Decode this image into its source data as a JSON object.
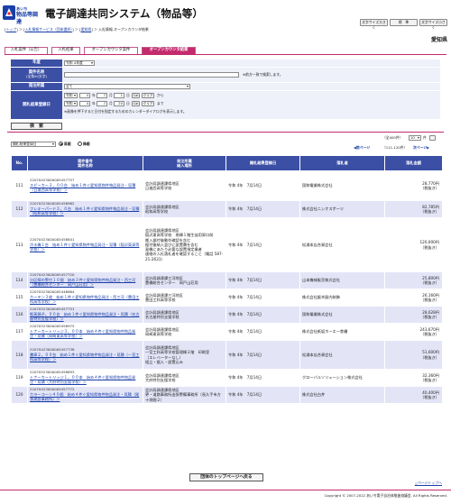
{
  "header": {
    "logo_small": "あいち",
    "logo_main": "物品等調達",
    "system_name": "電子調達共同システム（物品等）",
    "buttons": [
      "文字サイズ大きく",
      "標　準",
      "文字サイズ小さく"
    ]
  },
  "breadcrumb": {
    "items": [
      "トップ",
      "入札情報サービス（団体選択）",
      "愛知県"
    ],
    "current": "入札情報-オープンカウンタ結果",
    "sep": "＞"
  },
  "org_name": "愛知県",
  "tabs": [
    "入札案件（公告）",
    "入札結果",
    "オープンカウンタ案件",
    "オープンカウンタ結果"
  ],
  "search": {
    "fiscal_year_label": "年度",
    "fiscal_year_value": "令和 4年度",
    "case_name_label": "案件名称",
    "case_name_sub": "(全角50文字)",
    "case_name_note": "※前方一致で検索します。",
    "issuer_label": "発注所属",
    "issuer_value": "全て",
    "date_label": "開札結果登録日",
    "date_from": {
      "era": "令和",
      "y": "4",
      "m": "7",
      "d": "1",
      "from_word": "から"
    },
    "date_to": {
      "era": "令和",
      "y": "4",
      "m": "7",
      "d": "20",
      "to_word": "まで"
    },
    "unit_y": "年",
    "unit_m": "月",
    "unit_d": "日",
    "cal_btn": "Cal",
    "clear_btn": "クリア",
    "date_note": "※画像を押下すると日付を指定するためのカレンダーダイアログを表示します。",
    "search_btn": "検　索"
  },
  "list_controls": {
    "sort_value": "開札結果登録日",
    "asc": "昇順",
    "desc": "降順",
    "total": "（全400件）",
    "per_page": "10",
    "per_page_unit": "件",
    "prev": "前ページ",
    "range": "（111-120件）",
    "next": "次ページ"
  },
  "table": {
    "headers": {
      "no": "No.",
      "case": "案件番号\n案件名称",
      "issuer": "発注所属\n納入場所",
      "date": "開札結果登録日",
      "vendor": "落札者",
      "amount": "落札金額"
    },
    "tax_note": "（税抜き）",
    "rows": [
      {
        "no": "111",
        "id": "22070423000005457757",
        "name": "スピーカー３，００台　始め１件ぐ愛知県物件物品発注・見積（日進西高等学校）＞",
        "issuer": "会計局調達課県地区\n日進西高等学校",
        "date": "令和 4年　7月14日",
        "vendor": "国和電業株式会社",
        "amount": "28,770円"
      },
      {
        "no": "112",
        "id": "22070523000005456962",
        "name": "フレキーパード３，０台　始め１件ぐ愛知県物件物品発注・見積（昭和高等学校）＞",
        "issuer": "会計局調達課県地区\n昭和高等学校",
        "date": "令和 4年　7月14日",
        "vendor": "株式会社ニシオスポーツ",
        "amount": "82,785円"
      },
      {
        "no": "113",
        "id": "22070423000005458841",
        "name": "冷水機１台　始め１件ぐ愛知県物件物品発注・見積（稲沢東高等学校）＞",
        "issuer": "会計局調達課県地区\n稲沢東高等学校　南棟１階生徒用昇口前\n搬入据付後動作確認を含む\n据付後納入並びに設置費を含む\n発機にあたり必要な設置指定業者\n連絡の入札落札者を確認すること（電話 587-21-2631）",
        "date": "令和 4年　7月14日",
        "vendor": "松浦本店合資会社",
        "amount": "120,000円"
      },
      {
        "no": "114",
        "id": "22070423000005457720",
        "name": "分区線の警刃１０個　始め３件ぐ愛知県物件物品発注・西三河（豊橋総合センター　岡戸山荘用）＞",
        "issuer": "会計局調達課三河地区\n豊橋総合センター　岡戸山荘用",
        "date": "令和 4年　7月14日",
        "vendor": "山本機械販売株式会社",
        "amount": "25,800円"
      },
      {
        "no": "115",
        "id": "22070523000005446864",
        "name": "カーテン３枚　始め１件ぐ愛知県物件物品発注・西三河（豊田工科高等学校）＞",
        "issuer": "会計局調達課三河地区\n豊田工科高等学校",
        "date": "令和 4年　7月14日",
        "vendor": "株式会社飯木屋内装飾",
        "amount": "26,160円"
      },
      {
        "no": "116",
        "id": "22070523000005457751",
        "name": "態蒸鍋子，００台　始め１件ぐ愛知県物件物品発注・見積（名古屋特別支援学校）＞",
        "issuer": "会計局調達課県地区\n名古屋特別支援学校",
        "date": "令和 4年　7月14日",
        "vendor": "国和電業株式会社",
        "amount": "28,628円"
      },
      {
        "no": "117",
        "id": "22070523000005456975",
        "name": "トナーカートリッジ３，００本　始め４件ぐ愛知県物件物品発注・見積（岡崎東高等学校）＞",
        "issuer": "会計局調達課県地区\n岡崎東高等学校",
        "date": "令和 4年　7月14日",
        "vendor": "株式会社紙坂ホーエー食糧",
        "amount": "243,670円"
      },
      {
        "no": "118",
        "id": "22070423000005457738",
        "name": "書庫２，００台　始め１件ぐ愛知県物件物品発注・見積（一宮工科高等学校）＞",
        "issuer": "会計局調達課県地区\n一宮工科高等学校管理棟２階　印刷室\n（エレベーターなし）\n組立・据入・設置込み",
        "date": "令和 4年　7月14日",
        "vendor": "松浦本店合資会社",
        "amount": "51,600円"
      },
      {
        "no": "119",
        "id": "22070523000005458893",
        "name": "トナーカートリッジ１，００本　始め４件ぐ愛知県物件物品発注・見積（大府特別支援学校）＞",
        "issuer": "会計局調達課県地区\n大府特別支援学校",
        "date": "令和 4年　7月14日",
        "vendor": "グローバルソリューション株式会社",
        "amount": "32,360円"
      },
      {
        "no": "120",
        "id": "22070423000005457772",
        "name": "カラーコーン４０個　始め４件ぐ愛知県物件物品発注・見積（尾張建設事務所）＞",
        "issuer": "会計局調達課県地区\n更・道路事務所出張警備事務所（長久手市方十袋間２）",
        "date": "令和 4年　7月14日",
        "vendor": "株式会社白井",
        "amount": "40,400円"
      }
    ]
  },
  "footer": {
    "top_page_btn": "団体のトップページへ戻る",
    "go_top": "△ページトップへ",
    "copyright": "Copyright © 2007-2022 あいち電子自治体推進協議会. All Rights Reserved."
  },
  "colors": {
    "accent": "#c42a6e",
    "header_navy": "#3b4fa5",
    "row_alt": "#e3e5f7",
    "link": "#1a3fa8"
  }
}
